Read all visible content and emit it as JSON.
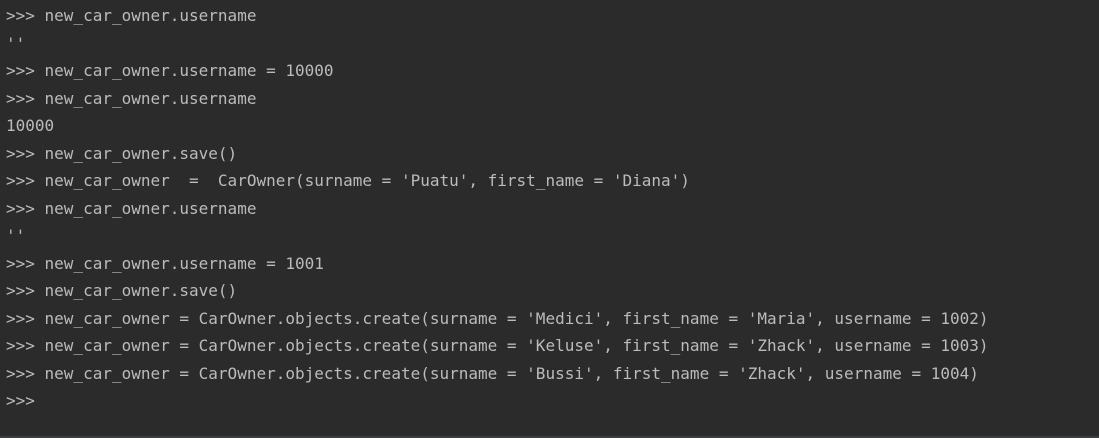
{
  "console": {
    "lines": [
      {
        "prompt": ">>> ",
        "text": "new_car_owner.username"
      },
      {
        "prompt": "",
        "text": "''"
      },
      {
        "prompt": ">>> ",
        "text": "new_car_owner.username = 10000"
      },
      {
        "prompt": ">>> ",
        "text": "new_car_owner.username"
      },
      {
        "prompt": "",
        "text": "10000"
      },
      {
        "prompt": ">>> ",
        "text": "new_car_owner.save()"
      },
      {
        "prompt": ">>> ",
        "text": "new_car_owner  =  CarOwner(surname = 'Puatu', first_name = 'Diana')"
      },
      {
        "prompt": ">>> ",
        "text": "new_car_owner.username"
      },
      {
        "prompt": "",
        "text": "''"
      },
      {
        "prompt": ">>> ",
        "text": "new_car_owner.username = 1001"
      },
      {
        "prompt": ">>> ",
        "text": "new_car_owner.save()"
      },
      {
        "prompt": ">>> ",
        "text": "new_car_owner = CarOwner.objects.create(surname = 'Medici', first_name = 'Maria', username = 1002)"
      },
      {
        "prompt": ">>> ",
        "text": "new_car_owner = CarOwner.objects.create(surname = 'Keluse', first_name = 'Zhack', username = 1003)"
      },
      {
        "prompt": ">>> ",
        "text": "new_car_owner = CarOwner.objects.create(surname = 'Bussi', first_name = 'Zhack', username = 1004)"
      },
      {
        "prompt": ">>> ",
        "text": ""
      }
    ]
  },
  "colors": {
    "background": "#2b2b2b",
    "text": "#bbbbbb"
  }
}
